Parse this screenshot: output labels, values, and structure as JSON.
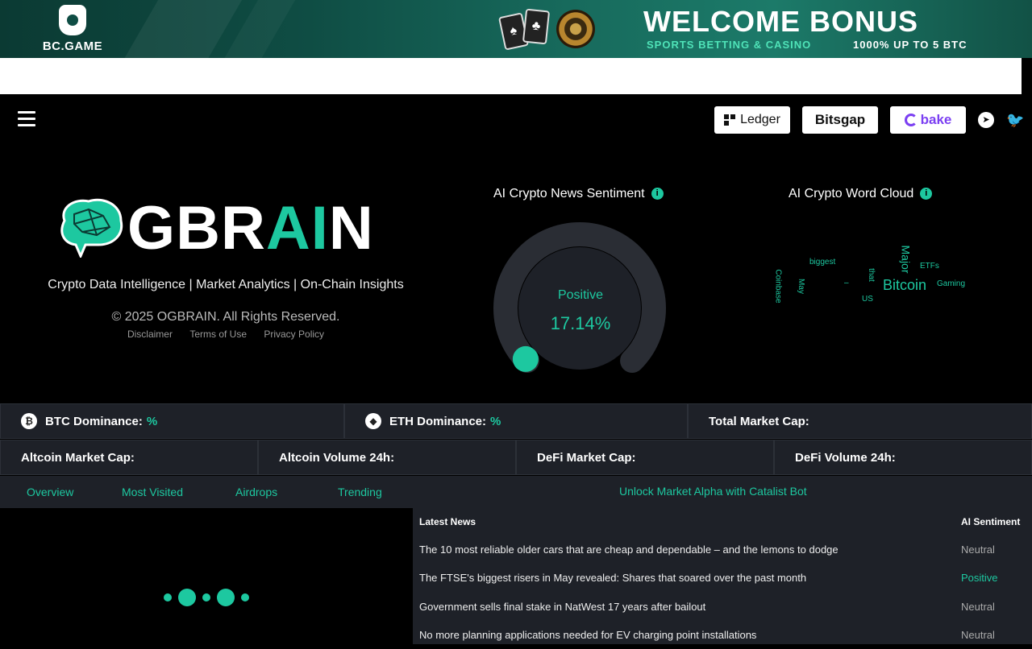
{
  "banner": {
    "brand": "BC.GAME",
    "title": "WELCOME BONUS",
    "subtitle_left": "SPORTS BETTING & CASINO",
    "subtitle_right": "1000% UP TO 5 BTC",
    "card_glyphs": [
      "♠",
      "♣"
    ]
  },
  "nav": {
    "sponsors": [
      "Ledger",
      "Bitsgap",
      "bake"
    ],
    "social_icons": [
      "telegram-icon",
      "twitter-icon"
    ]
  },
  "hero": {
    "brand_plain": "GBR",
    "brand_accent": "AI",
    "brand_end": "N",
    "tagline": "Crypto Data Intelligence | Market Analytics | On-Chain Insights",
    "copyright": "© 2025 OGBRAIN. All Rights Reserved.",
    "links": [
      "Disclaimer",
      "Terms of Use",
      "Privacy Policy"
    ]
  },
  "sentiment": {
    "title": "AI Crypto News Sentiment",
    "label": "Positive",
    "value_text": "17.14%",
    "value": 17.14
  },
  "wordcloud": {
    "title": "AI Crypto Word Cloud",
    "words": [
      "biggest",
      "that",
      "Major",
      "ETFs",
      "Coinbase",
      "May",
      "–",
      "Bitcoin",
      "Gaming",
      "US"
    ]
  },
  "stats": {
    "btc_label": "BTC Dominance:",
    "btc_value": "%",
    "eth_label": "ETH Dominance:",
    "eth_value": "%",
    "total_cap": "Total Market Cap:",
    "altcoin_cap": "Altcoin Market Cap:",
    "altcoin_volume": "Altcoin Volume 24h:",
    "defi_cap": "DeFi Market Cap:",
    "defi_volume": "DeFi Volume 24h:"
  },
  "tabs": [
    "Overview",
    "Most Visited",
    "Airdrops",
    "Trending"
  ],
  "promo": "Unlock Market Alpha with Catalist Bot",
  "news": {
    "col_title": "Latest News",
    "col_sentiment": "AI Sentiment",
    "rows": [
      {
        "title": "The 10 most reliable older cars that are cheap and dependable – and the lemons to dodge",
        "sentiment": "Neutral"
      },
      {
        "title": "The FTSE's biggest risers in May revealed: Shares that soared over the past month",
        "sentiment": "Positive"
      },
      {
        "title": "Government sells final stake in NatWest 17 years after bailout",
        "sentiment": "Neutral"
      },
      {
        "title": "No more planning applications needed for EV charging point installations",
        "sentiment": "Neutral"
      }
    ]
  },
  "colors": {
    "accent": "#1dc8a0",
    "panel": "#1e2128",
    "background": "#000000"
  }
}
